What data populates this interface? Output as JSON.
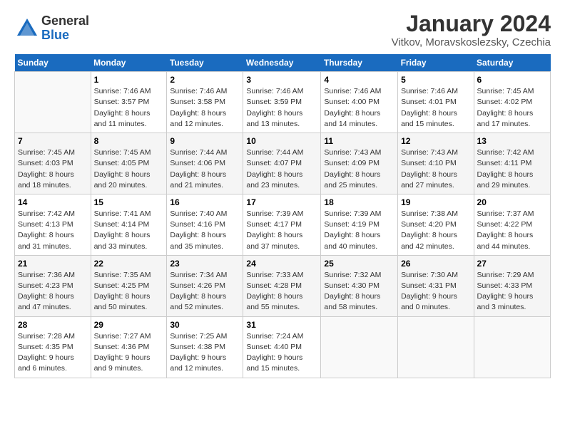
{
  "header": {
    "logo_general": "General",
    "logo_blue": "Blue",
    "month_title": "January 2024",
    "location": "Vitkov, Moravskoslezsky, Czechia"
  },
  "days_of_week": [
    "Sunday",
    "Monday",
    "Tuesday",
    "Wednesday",
    "Thursday",
    "Friday",
    "Saturday"
  ],
  "weeks": [
    [
      {
        "day": "",
        "info": ""
      },
      {
        "day": "1",
        "info": "Sunrise: 7:46 AM\nSunset: 3:57 PM\nDaylight: 8 hours\nand 11 minutes."
      },
      {
        "day": "2",
        "info": "Sunrise: 7:46 AM\nSunset: 3:58 PM\nDaylight: 8 hours\nand 12 minutes."
      },
      {
        "day": "3",
        "info": "Sunrise: 7:46 AM\nSunset: 3:59 PM\nDaylight: 8 hours\nand 13 minutes."
      },
      {
        "day": "4",
        "info": "Sunrise: 7:46 AM\nSunset: 4:00 PM\nDaylight: 8 hours\nand 14 minutes."
      },
      {
        "day": "5",
        "info": "Sunrise: 7:46 AM\nSunset: 4:01 PM\nDaylight: 8 hours\nand 15 minutes."
      },
      {
        "day": "6",
        "info": "Sunrise: 7:45 AM\nSunset: 4:02 PM\nDaylight: 8 hours\nand 17 minutes."
      }
    ],
    [
      {
        "day": "7",
        "info": "Sunrise: 7:45 AM\nSunset: 4:03 PM\nDaylight: 8 hours\nand 18 minutes."
      },
      {
        "day": "8",
        "info": "Sunrise: 7:45 AM\nSunset: 4:05 PM\nDaylight: 8 hours\nand 20 minutes."
      },
      {
        "day": "9",
        "info": "Sunrise: 7:44 AM\nSunset: 4:06 PM\nDaylight: 8 hours\nand 21 minutes."
      },
      {
        "day": "10",
        "info": "Sunrise: 7:44 AM\nSunset: 4:07 PM\nDaylight: 8 hours\nand 23 minutes."
      },
      {
        "day": "11",
        "info": "Sunrise: 7:43 AM\nSunset: 4:09 PM\nDaylight: 8 hours\nand 25 minutes."
      },
      {
        "day": "12",
        "info": "Sunrise: 7:43 AM\nSunset: 4:10 PM\nDaylight: 8 hours\nand 27 minutes."
      },
      {
        "day": "13",
        "info": "Sunrise: 7:42 AM\nSunset: 4:11 PM\nDaylight: 8 hours\nand 29 minutes."
      }
    ],
    [
      {
        "day": "14",
        "info": "Sunrise: 7:42 AM\nSunset: 4:13 PM\nDaylight: 8 hours\nand 31 minutes."
      },
      {
        "day": "15",
        "info": "Sunrise: 7:41 AM\nSunset: 4:14 PM\nDaylight: 8 hours\nand 33 minutes."
      },
      {
        "day": "16",
        "info": "Sunrise: 7:40 AM\nSunset: 4:16 PM\nDaylight: 8 hours\nand 35 minutes."
      },
      {
        "day": "17",
        "info": "Sunrise: 7:39 AM\nSunset: 4:17 PM\nDaylight: 8 hours\nand 37 minutes."
      },
      {
        "day": "18",
        "info": "Sunrise: 7:39 AM\nSunset: 4:19 PM\nDaylight: 8 hours\nand 40 minutes."
      },
      {
        "day": "19",
        "info": "Sunrise: 7:38 AM\nSunset: 4:20 PM\nDaylight: 8 hours\nand 42 minutes."
      },
      {
        "day": "20",
        "info": "Sunrise: 7:37 AM\nSunset: 4:22 PM\nDaylight: 8 hours\nand 44 minutes."
      }
    ],
    [
      {
        "day": "21",
        "info": "Sunrise: 7:36 AM\nSunset: 4:23 PM\nDaylight: 8 hours\nand 47 minutes."
      },
      {
        "day": "22",
        "info": "Sunrise: 7:35 AM\nSunset: 4:25 PM\nDaylight: 8 hours\nand 50 minutes."
      },
      {
        "day": "23",
        "info": "Sunrise: 7:34 AM\nSunset: 4:26 PM\nDaylight: 8 hours\nand 52 minutes."
      },
      {
        "day": "24",
        "info": "Sunrise: 7:33 AM\nSunset: 4:28 PM\nDaylight: 8 hours\nand 55 minutes."
      },
      {
        "day": "25",
        "info": "Sunrise: 7:32 AM\nSunset: 4:30 PM\nDaylight: 8 hours\nand 58 minutes."
      },
      {
        "day": "26",
        "info": "Sunrise: 7:30 AM\nSunset: 4:31 PM\nDaylight: 9 hours\nand 0 minutes."
      },
      {
        "day": "27",
        "info": "Sunrise: 7:29 AM\nSunset: 4:33 PM\nDaylight: 9 hours\nand 3 minutes."
      }
    ],
    [
      {
        "day": "28",
        "info": "Sunrise: 7:28 AM\nSunset: 4:35 PM\nDaylight: 9 hours\nand 6 minutes."
      },
      {
        "day": "29",
        "info": "Sunrise: 7:27 AM\nSunset: 4:36 PM\nDaylight: 9 hours\nand 9 minutes."
      },
      {
        "day": "30",
        "info": "Sunrise: 7:25 AM\nSunset: 4:38 PM\nDaylight: 9 hours\nand 12 minutes."
      },
      {
        "day": "31",
        "info": "Sunrise: 7:24 AM\nSunset: 4:40 PM\nDaylight: 9 hours\nand 15 minutes."
      },
      {
        "day": "",
        "info": ""
      },
      {
        "day": "",
        "info": ""
      },
      {
        "day": "",
        "info": ""
      }
    ]
  ]
}
